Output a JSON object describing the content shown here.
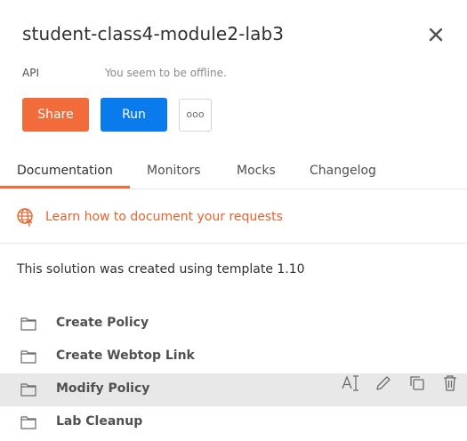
{
  "header": {
    "title": "student-class4-module2-lab3",
    "type_label": "API",
    "status_text": "You seem to be offline.",
    "close_icon": "close-icon"
  },
  "actions": {
    "share_label": "Share",
    "run_label": "Run",
    "more_label": "ooo",
    "share_color": "#f26b3a",
    "run_color": "#097bed"
  },
  "tabs": [
    {
      "label": "Documentation",
      "active": true
    },
    {
      "label": "Monitors",
      "active": false
    },
    {
      "label": "Mocks",
      "active": false
    },
    {
      "label": "Changelog",
      "active": false
    }
  ],
  "learn": {
    "icon": "globe-icon",
    "label": "Learn how to document your requests",
    "color": "#e8632f"
  },
  "description": "This solution was created using template 1.10",
  "folders": [
    {
      "label": "Create Policy",
      "icon": "folder-icon",
      "hovered": false
    },
    {
      "label": "Create Webtop Link",
      "icon": "folder-icon",
      "hovered": false
    },
    {
      "label": "Modify Policy",
      "icon": "folder-icon",
      "hovered": true
    },
    {
      "label": "Lab Cleanup",
      "icon": "folder-icon",
      "hovered": false
    }
  ],
  "row_actions": [
    "rename-icon",
    "edit-icon",
    "duplicate-icon",
    "delete-icon"
  ]
}
